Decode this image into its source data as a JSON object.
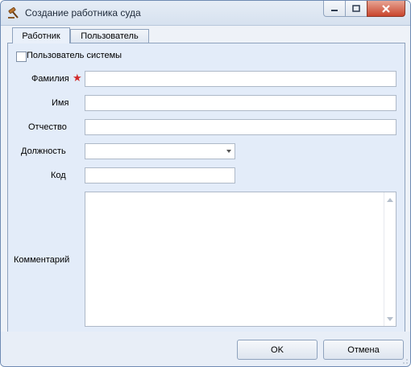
{
  "window": {
    "title": "Создание работника суда",
    "controls": [
      "minimize-icon",
      "maximize-icon",
      "close-icon"
    ]
  },
  "tabs": [
    {
      "label": "Работник",
      "active": true
    },
    {
      "label": "Пользователь",
      "active": false
    }
  ],
  "form": {
    "system_user_checkbox": {
      "label": "Пользователь системы",
      "checked": false
    },
    "fields": {
      "surname": {
        "label": "Фамилия",
        "value": "",
        "required": true
      },
      "name": {
        "label": "Имя",
        "value": ""
      },
      "patronymic": {
        "label": "Отчество",
        "value": ""
      },
      "position": {
        "label": "Должность",
        "value": ""
      },
      "code": {
        "label": "Код",
        "value": ""
      },
      "comment": {
        "label": "Комментарий",
        "value": ""
      }
    },
    "required_marker": "★"
  },
  "buttons": {
    "ok": "OK",
    "cancel": "Отмена"
  },
  "colors": {
    "panel": "#e3ecf9",
    "accent_border": "#8ea2bd",
    "required": "#d12a2a"
  }
}
